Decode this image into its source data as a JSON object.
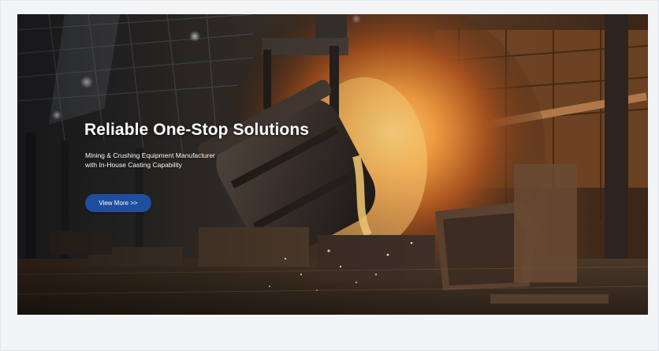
{
  "hero": {
    "title": "Reliable One-Stop Solutions",
    "subtitle_line1": "Mining & Crushing Equipment Manufacturer",
    "subtitle_line2": "with In-House Casting Capability",
    "cta_label": "View  More >>",
    "background_image": "foundry-ladle-pouring-molten-metal",
    "cta_color": "#1f4e9e"
  }
}
